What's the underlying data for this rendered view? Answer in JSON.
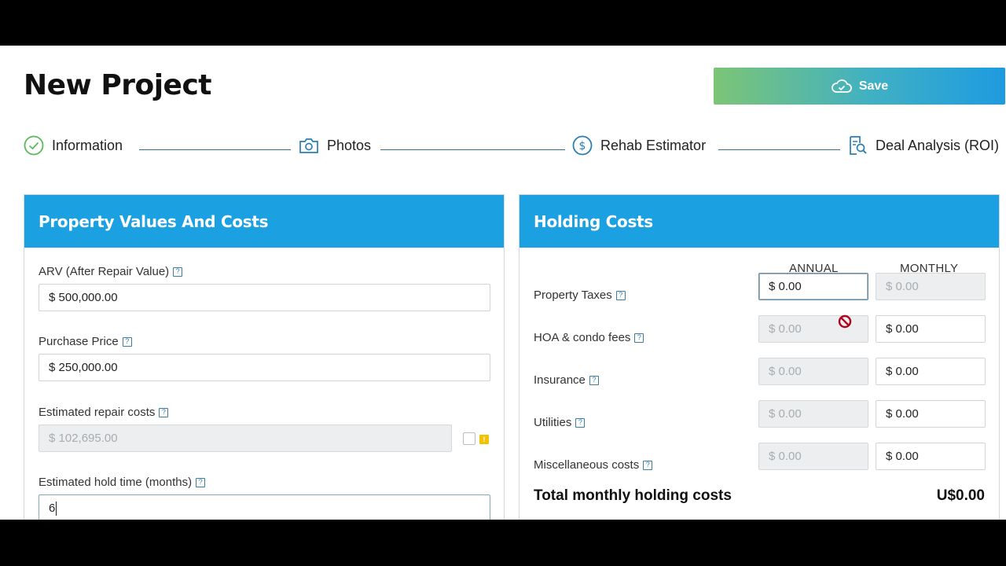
{
  "page": {
    "title": "New Project"
  },
  "toolbar": {
    "save_label": "Save"
  },
  "steps": [
    {
      "label": "Information",
      "icon": "check-circle-icon",
      "status": "completed"
    },
    {
      "label": "Photos",
      "icon": "camera-icon"
    },
    {
      "label": "Rehab Estimator",
      "icon": "dollar-circle-icon"
    },
    {
      "label": "Deal Analysis (ROI)",
      "icon": "report-search-icon"
    }
  ],
  "property": {
    "title": "Property Values And Costs",
    "arv": {
      "label": "ARV (After Repair Value)",
      "value": "$ 500,000.00"
    },
    "purchase": {
      "label": "Purchase Price",
      "value": "$ 250,000.00"
    },
    "repair": {
      "label": "Estimated repair costs",
      "value": "$ 102,695.00"
    },
    "hold": {
      "label": "Estimated hold time (months)",
      "value": "6"
    }
  },
  "holding": {
    "title": "Holding Costs",
    "col_annual": "ANNUAL",
    "col_monthly": "MONTHLY",
    "rows": [
      {
        "label": "Property Taxes",
        "annual": "$ 0.00",
        "monthly": "$ 0.00"
      },
      {
        "label": "HOA & condo fees",
        "annual": "$ 0.00",
        "monthly": "$ 0.00"
      },
      {
        "label": "Insurance",
        "annual": "$ 0.00",
        "monthly": "$ 0.00"
      },
      {
        "label": "Utilities",
        "annual": "$ 0.00",
        "monthly": "$ 0.00"
      },
      {
        "label": "Miscellaneous costs",
        "annual": "$ 0.00",
        "monthly": "$ 0.00"
      }
    ],
    "total_label": "Total monthly holding costs",
    "total_value": "U$0.00"
  },
  "help_glyph": "?",
  "warn_glyph": "!",
  "colors": {
    "header": "#1ba0e2",
    "accent_green": "#7cc576",
    "link": "#3a7ca5"
  }
}
